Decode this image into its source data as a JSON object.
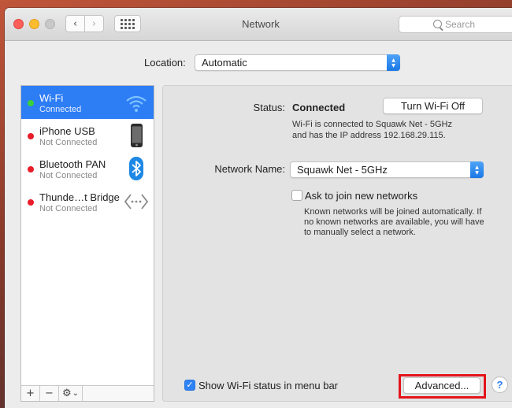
{
  "window": {
    "title": "Network"
  },
  "toolbar": {
    "back_glyph": "‹",
    "forward_glyph": "›",
    "search_placeholder": "Search",
    "grid_icon": "grid-icon"
  },
  "location": {
    "label": "Location:",
    "value": "Automatic"
  },
  "services": [
    {
      "name": "Wi-Fi",
      "status": "Connected",
      "status_color": "#39d23c",
      "icon": "wifi-icon",
      "selected": true
    },
    {
      "name": "iPhone USB",
      "status": "Not Connected",
      "status_color": "#e81c2a",
      "icon": "iphone-icon",
      "selected": false
    },
    {
      "name": "Bluetooth PAN",
      "status": "Not Connected",
      "status_color": "#e81c2a",
      "icon": "bluetooth-icon",
      "selected": false
    },
    {
      "name": "Thunde…t Bridge",
      "status": "Not Connected",
      "status_color": "#e81c2a",
      "icon": "thunderbolt-bridge-icon",
      "selected": false
    }
  ],
  "sidebar_footer": {
    "add": "+",
    "remove": "−",
    "gear": "⚙",
    "gear_chevron": "⌄"
  },
  "detail": {
    "status_label": "Status:",
    "status_value": "Connected",
    "turn_off_button": "Turn Wi-Fi Off",
    "status_desc_line1": "Wi-Fi is connected to Squawk Net - 5GHz",
    "status_desc_line2": "and has the IP address 192.168.29.115.",
    "network_name_label": "Network Name:",
    "network_name_value": "Squawk Net - 5GHz",
    "ask_join_label": "Ask to join new networks",
    "ask_join_checked": false,
    "ask_join_desc_line1": "Known networks will be joined automatically. If",
    "ask_join_desc_line2": "no known networks are available, you will have",
    "ask_join_desc_line3": "to manually select a network.",
    "show_status_label": "Show Wi-Fi status in menu bar",
    "show_status_checked": true,
    "advanced_button": "Advanced...",
    "help_button": "?"
  },
  "colors": {
    "accent": "#2d7df5",
    "highlight": "#e4131b"
  }
}
